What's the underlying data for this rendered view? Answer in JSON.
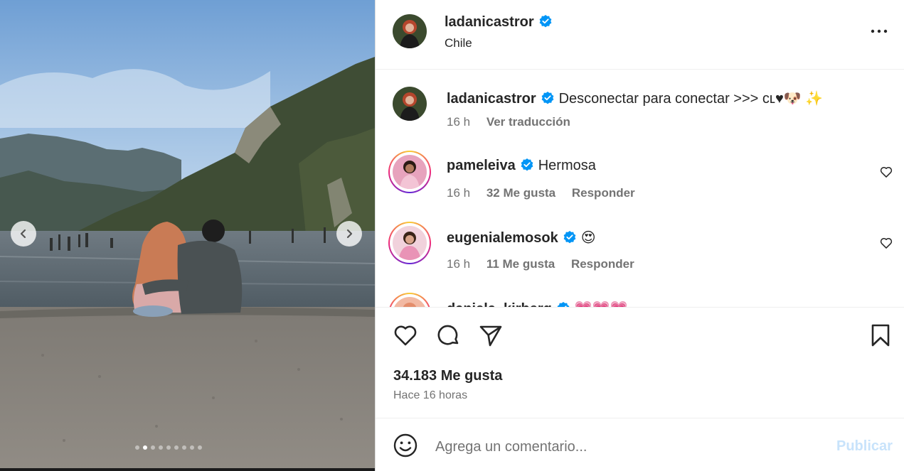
{
  "post": {
    "author": "ladanicastror",
    "location": "Chile",
    "caption_user": "ladanicastror",
    "caption_text": "Desconectar para conectar >>> ᴄʟ♥🐶 ✨",
    "caption_time": "16 h",
    "translate_label": "Ver traducción",
    "likes_text": "34.183 Me gusta",
    "time_ago": "Hace 16 horas"
  },
  "carousel": {
    "slide_count": 9,
    "active_index": 1
  },
  "comments": [
    {
      "user": "pameleiva",
      "text": "Hermosa",
      "time": "16 h",
      "likes": "32 Me gusta",
      "reply": "Responder"
    },
    {
      "user": "eugenialemosok",
      "text": "😍",
      "time": "16 h",
      "likes": "11 Me gusta",
      "reply": "Responder"
    },
    {
      "user": "daniela_kirberg",
      "text": "💗💗💗",
      "time": "",
      "likes": "",
      "reply": ""
    }
  ],
  "composer": {
    "placeholder": "Agrega un comentario...",
    "publish_label": "Publicar"
  },
  "colors": {
    "verified": "#0095f6",
    "publish_disabled": "#c8e3fb",
    "muted_text": "#737373"
  },
  "icons": [
    "chevron-left-icon",
    "chevron-right-icon",
    "more-options-icon",
    "verified-badge-icon",
    "heart-icon",
    "comment-icon",
    "share-icon",
    "bookmark-icon",
    "emoji-icon"
  ]
}
